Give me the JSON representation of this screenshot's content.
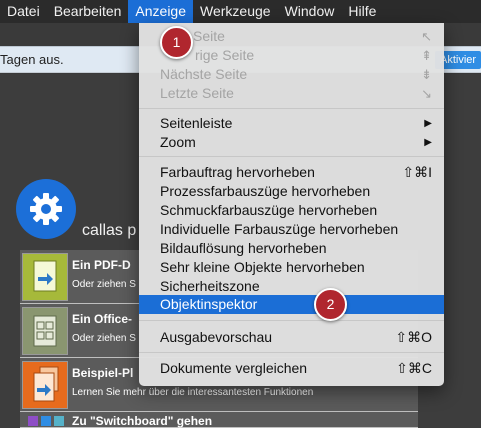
{
  "menubar": {
    "items": [
      {
        "label": "Datei"
      },
      {
        "label": "Bearbeiten"
      },
      {
        "label": "Anzeige"
      },
      {
        "label": "Werkzeuge"
      },
      {
        "label": "Window"
      },
      {
        "label": "Hilfe"
      }
    ]
  },
  "infobar": {
    "text": "Tagen aus.",
    "button": "Aktivier"
  },
  "app": {
    "title": "callas p",
    "rows": [
      {
        "title": "Ein PDF-D",
        "sub": "Oder ziehen S"
      },
      {
        "title": "Ein Office-",
        "sub": "Oder ziehen S"
      },
      {
        "title": "Beispiel-Pl",
        "sub": "Lernen Sie mehr über die interessantesten Funktionen"
      },
      {
        "title": "Zu \"Switchboard\" gehen",
        "sub": ""
      }
    ]
  },
  "menu": {
    "first_page": "Seite",
    "prev_page": "rige Seite",
    "next_page": "Nächste Seite",
    "last_page": "Letzte Seite",
    "sidebar": "Seitenleiste",
    "zoom": "Zoom",
    "color_separations": "Farbauftrag hervorheben",
    "color_separations_sc": "⇧⌘I",
    "process_separations": "Prozessfarbauszüge hervorheben",
    "spot_separations": "Schmuckfarbauszüge hervorheben",
    "individual_separations": "Individuelle Farbauszüge hervorheben",
    "image_resolution": "Bildauflösung hervorheben",
    "small_objects": "Sehr kleine Objekte hervorheben",
    "safety_zone": "Sicherheitszone",
    "object_inspector": "Objektinspektor",
    "output_preview": "Ausgabevorschau",
    "output_preview_sc": "⇧⌘O",
    "compare_docs": "Dokumente vergleichen",
    "compare_docs_sc": "⇧⌘C"
  },
  "badges": {
    "one": "1",
    "two": "2"
  }
}
